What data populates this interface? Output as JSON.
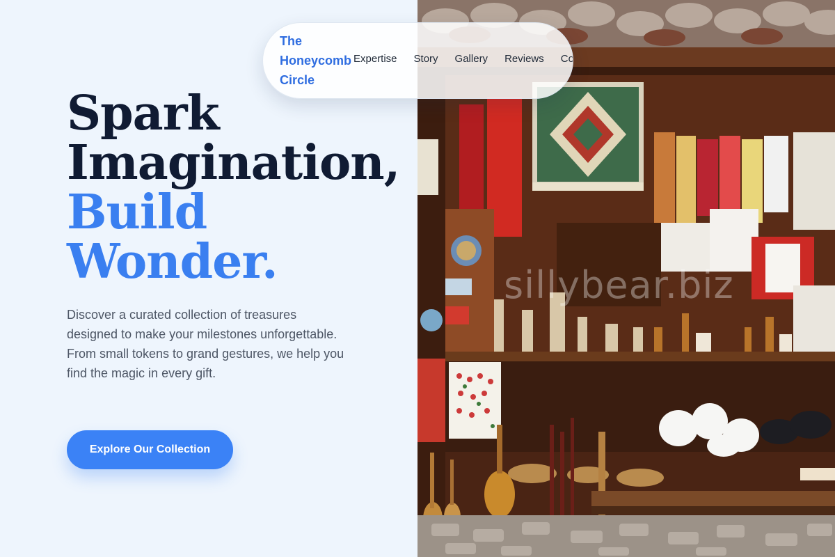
{
  "brand": {
    "name": "The Honeycomb Circle"
  },
  "nav": {
    "links": [
      "Expertise",
      "Story",
      "Gallery",
      "Reviews",
      "Contact"
    ]
  },
  "hero": {
    "headline": {
      "line1": "Spark",
      "line2": "Imagination,",
      "line3": "Build",
      "line4": "Wonder."
    },
    "description": "Discover a curated collection of treasures designed to make your milestones unforgettable. From small tokens to grand gestures, we help you find the magic in every gift.",
    "cta_label": "Explore Our Collection"
  },
  "photo": {
    "watermark": "sillybear.biz"
  },
  "colors": {
    "background": "#eef5fd",
    "headline": "#101b33",
    "accent": "#3a7ff0",
    "brand": "#2f6de0",
    "button": "#3b82f6",
    "body_text": "#4d5665"
  }
}
